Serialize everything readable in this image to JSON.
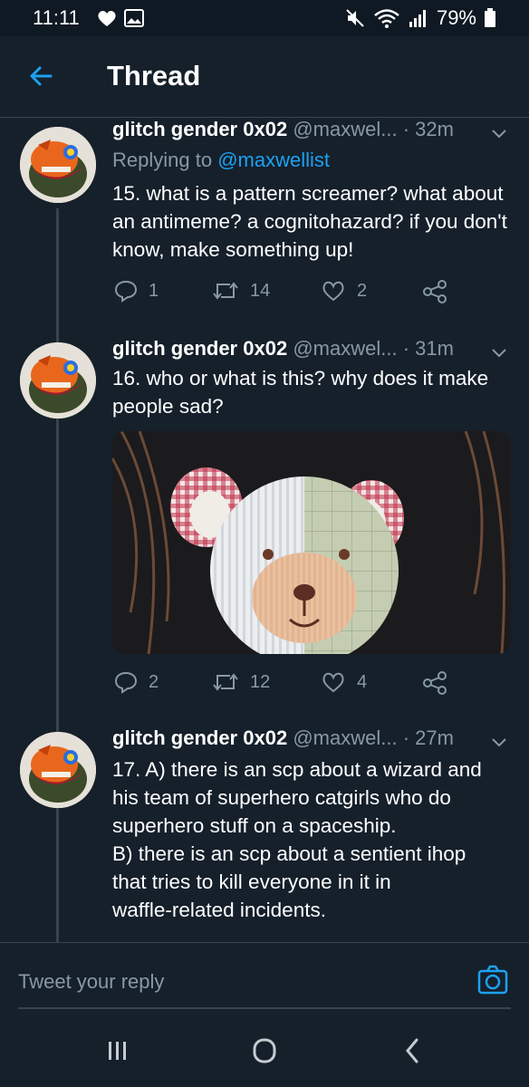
{
  "status": {
    "time": "11:11",
    "battery": "79%"
  },
  "header": {
    "title": "Thread"
  },
  "tweets": [
    {
      "name": "glitch gender 0x02",
      "handle": "@maxwel...",
      "time": "· 32m",
      "replying_prefix": "Replying to",
      "replying_to": "@maxwellist",
      "text": "15. what is a pattern screamer? what about an antimeme? a cognitohazard? if you don't know, make something up!",
      "replies": "1",
      "retweets": "14",
      "likes": "2"
    },
    {
      "name": "glitch gender 0x02",
      "handle": "@maxwel...",
      "time": "· 31m",
      "text": "16. who or what is this? why does it make people sad?",
      "replies": "2",
      "retweets": "12",
      "likes": "4"
    },
    {
      "name": "glitch gender 0x02",
      "handle": "@maxwel...",
      "time": "· 27m",
      "text_lines": [
        "17. A) there is an scp about a wizard and",
        "his team of superhero catgirls who do",
        "superhero stuff on a spaceship.",
        "B) there is an scp about a sentient ihop",
        "that tries to kill everyone in it in",
        "waffle-related incidents."
      ]
    }
  ],
  "reply": {
    "placeholder": "Tweet your reply"
  },
  "colors": {
    "background": "#15202b",
    "accent": "#1da1f2",
    "muted": "#8899a6",
    "divider": "#38444d"
  },
  "icons": [
    "heart-icon",
    "gallery-icon",
    "mute-icon",
    "wifi-icon",
    "signal-icon",
    "battery-icon",
    "back-arrow-icon",
    "chevron-down-icon",
    "reply-icon",
    "retweet-icon",
    "like-icon",
    "share-icon",
    "camera-icon",
    "recents-icon",
    "home-icon",
    "back-icon"
  ]
}
